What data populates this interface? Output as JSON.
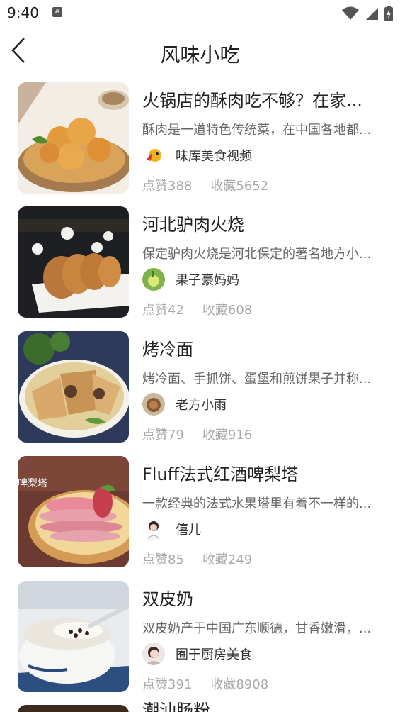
{
  "status_bar": {
    "time": "9:40",
    "app_icon": "A"
  },
  "header": {
    "title": "风味小吃",
    "back_icon": "chevron-left-icon"
  },
  "items": [
    {
      "title": "火锅店的酥肉吃不够？在家...",
      "desc": "酥肉是一道特色传统菜，在中国各地都...",
      "author": "味库美食视频",
      "likes": "点赞388",
      "favorites": "收藏5652",
      "image_caption": ""
    },
    {
      "title": "河北驴肉火烧",
      "desc": "保定驴肉火烧是河北保定的著名地方小...",
      "author": "果子豪妈妈",
      "likes": "点赞42",
      "favorites": "收藏608",
      "image_caption": ""
    },
    {
      "title": "烤冷面",
      "desc": "烤冷面、手抓饼、蛋堡和煎饼果子并称...",
      "author": "老方小雨",
      "likes": "点赞79",
      "favorites": "收藏916",
      "image_caption": ""
    },
    {
      "title": "Fluff法式红酒啤梨塔",
      "desc": "一款经典的法式水果塔里有着不一样的...",
      "author": "僖儿",
      "likes": "点赞85",
      "favorites": "收藏249",
      "image_caption": "啤梨塔"
    },
    {
      "title": "双皮奶",
      "desc": "双皮奶产于中国广东顺德，甘香嫩滑，...",
      "author": "囿于厨房美食",
      "likes": "点赞391",
      "favorites": "收藏8908",
      "image_caption": ""
    }
  ],
  "partial_item": {
    "title": "潮汕肠粉"
  }
}
